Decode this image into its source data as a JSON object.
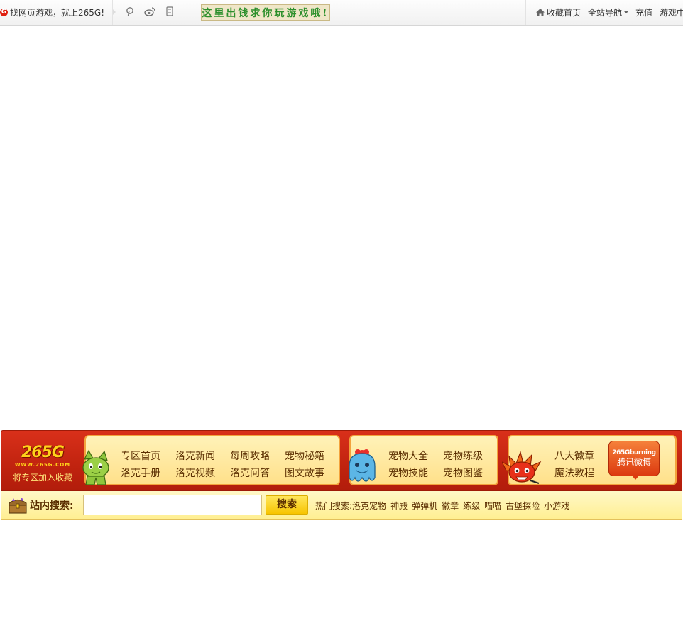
{
  "topbar": {
    "logo_letter": "G",
    "slogan": "找网页游戏，就上265G!",
    "icons": [
      "pinterest-icon",
      "weibo-icon",
      "mobile-icon"
    ],
    "banner_text": "这里出钱求你玩游戏哦!",
    "links": {
      "favorite": "收藏首页",
      "site_nav": "全站导航",
      "recharge": "充值",
      "game_center": "游戏中"
    }
  },
  "zone": {
    "logo_text": "265G",
    "logo_url": "WWW.265G.COM",
    "add_favorite": "将专区加入收藏",
    "group1": [
      "专区首页",
      "洛克新闻",
      "每周攻略",
      "宠物秘籍",
      "洛克手册",
      "洛克视频",
      "洛克问答",
      "图文故事"
    ],
    "group2": [
      "宠物大全",
      "宠物练级",
      "宠物技能",
      "宠物图鉴"
    ],
    "group3": [
      "八大徽章",
      "魔法教程"
    ],
    "weibo_small": "265Gburning",
    "weibo_big": "腾讯微博"
  },
  "search": {
    "label": "站内搜索:",
    "input_value": "",
    "button": "搜索",
    "hot_label": "热门搜索:",
    "hot_items": [
      "洛克宠物",
      "神殿",
      "弹弹机",
      "徽章",
      "练级",
      "喵喵",
      "古堡探险",
      "小游戏"
    ]
  },
  "colors": {
    "zone_red": "#c0230f",
    "panel_yellow": "#ffe08a",
    "search_yellow": "#ffef92",
    "logo_yellow": "#ffd21a"
  }
}
